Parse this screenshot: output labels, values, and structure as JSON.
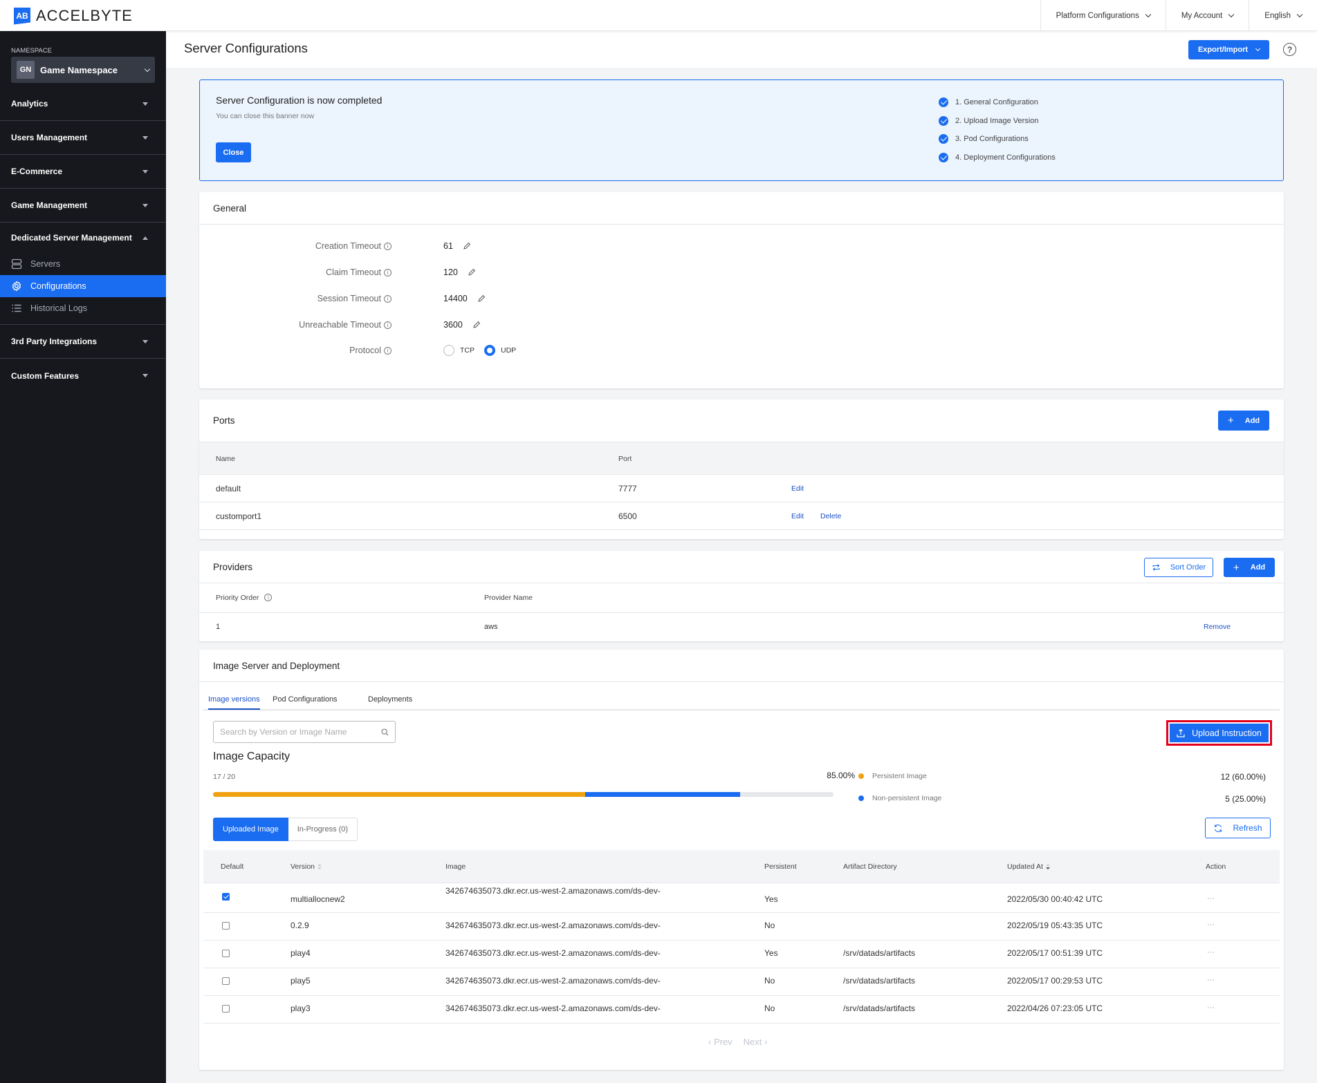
{
  "topbar": {
    "brand": "ACCELBYTE",
    "logo_mark": "AB",
    "nav": [
      {
        "label": "Platform Configurations"
      },
      {
        "label": "My Account"
      },
      {
        "label": "English"
      }
    ]
  },
  "sidebar": {
    "namespace_label": "NAMESPACE",
    "namespace_initials": "GN",
    "namespace_name": "Game Namespace",
    "groups": [
      {
        "label": "Analytics",
        "expanded": false
      },
      {
        "label": "Users Management",
        "expanded": false
      },
      {
        "label": "E-Commerce",
        "expanded": false
      },
      {
        "label": "Game Management",
        "expanded": false
      },
      {
        "label": "Dedicated Server Management",
        "expanded": true
      },
      {
        "label": "3rd Party Integrations",
        "expanded": false
      },
      {
        "label": "Custom Features",
        "expanded": false
      }
    ],
    "dsm_items": [
      {
        "label": "Servers",
        "icon": "server-icon",
        "active": false
      },
      {
        "label": "Configurations",
        "icon": "gear-icon",
        "active": true
      },
      {
        "label": "Historical Logs",
        "icon": "list-icon",
        "active": false
      }
    ]
  },
  "page": {
    "title": "Server Configurations",
    "export_label": "Export/Import",
    "help_icon": "?"
  },
  "banner": {
    "title": "Server Configuration is now completed",
    "subtitle": "You can close this banner now",
    "close_label": "Close",
    "steps": [
      {
        "label": "1. General Configuration",
        "done": true
      },
      {
        "label": "2. Upload Image Version",
        "done": true
      },
      {
        "label": "3. Pod Configurations",
        "done": true
      },
      {
        "label": "4. Deployment Configurations",
        "done": true
      }
    ]
  },
  "general": {
    "title": "General",
    "fields": [
      {
        "label": "Creation Timeout",
        "value": "61"
      },
      {
        "label": "Claim Timeout",
        "value": "120"
      },
      {
        "label": "Session Timeout",
        "value": "14400"
      },
      {
        "label": "Unreachable Timeout",
        "value": "3600"
      }
    ],
    "protocol_label": "Protocol",
    "protocol_options": [
      "TCP",
      "UDP"
    ],
    "protocol_selected": "UDP"
  },
  "ports": {
    "title": "Ports",
    "add_label": "Add",
    "columns": [
      "Name",
      "Port"
    ],
    "rows": [
      {
        "name": "default",
        "port": "7777",
        "actions": [
          "Edit"
        ]
      },
      {
        "name": "customport1",
        "port": "6500",
        "actions": [
          "Edit",
          "Delete"
        ]
      }
    ]
  },
  "providers": {
    "title": "Providers",
    "sort_label": "Sort Order",
    "add_label": "Add",
    "columns": [
      "Priority Order",
      "Provider Name"
    ],
    "rows": [
      {
        "priority": "1",
        "name": "aws",
        "action": "Remove"
      }
    ]
  },
  "images": {
    "title": "Image Server and Deployment",
    "tabs": [
      {
        "label": "Image versions",
        "active": true
      },
      {
        "label": "Pod Configurations",
        "active": false
      },
      {
        "label": "Deployments",
        "active": false
      }
    ],
    "search_placeholder": "Search by Version or Image Name",
    "search_value": "",
    "upload_label": "Upload Instruction",
    "capacity": {
      "title": "Image Capacity",
      "count": "17 / 20",
      "used": 17,
      "total": 20,
      "percent_label": "85.00%",
      "persistent_fraction": 0.6,
      "nonpersistent_fraction": 0.25,
      "legend": [
        {
          "label": "Persistent Image",
          "value": "12 (60.00%)",
          "color": "#f0a10f"
        },
        {
          "label": "Non-persistent Image",
          "value": "5 (25.00%)",
          "color": "#1a6cf0"
        }
      ]
    },
    "segments": [
      {
        "label": "Uploaded Image",
        "active": true
      },
      {
        "label": "In-Progress (0)",
        "active": false
      }
    ],
    "refresh_label": "Refresh",
    "columns": [
      "Default",
      "Version",
      "Image",
      "Persistent",
      "Artifact Directory",
      "Updated At",
      "Action"
    ],
    "rows": [
      {
        "default": true,
        "version": "multiallocnew2",
        "image": "342674635073.dkr.ecr.us-west-2.amazonaws.com/ds-dev-",
        "persistent": "Yes",
        "artifact": "",
        "updated": "2022/05/30 00:40:42 UTC",
        "action": "···"
      },
      {
        "default": false,
        "version": "0.2.9",
        "image": "342674635073.dkr.ecr.us-west-2.amazonaws.com/ds-dev-",
        "persistent": "No",
        "artifact": "",
        "updated": "2022/05/19 05:43:35 UTC",
        "action": "···"
      },
      {
        "default": false,
        "version": "play4",
        "image": "342674635073.dkr.ecr.us-west-2.amazonaws.com/ds-dev-",
        "persistent": "Yes",
        "artifact": "/srv/datads/artifacts",
        "updated": "2022/05/17 00:51:39 UTC",
        "action": "···"
      },
      {
        "default": false,
        "version": "play5",
        "image": "342674635073.dkr.ecr.us-west-2.amazonaws.com/ds-dev-",
        "persistent": "No",
        "artifact": "/srv/datads/artifacts",
        "updated": "2022/05/17 00:29:53 UTC",
        "action": "···"
      },
      {
        "default": false,
        "version": "play3",
        "image": "342674635073.dkr.ecr.us-west-2.amazonaws.com/ds-dev-",
        "persistent": "No",
        "artifact": "/srv/datads/artifacts",
        "updated": "2022/04/26 07:23:05 UTC",
        "action": "···"
      }
    ],
    "pager": {
      "prev": "‹ Prev",
      "next": "Next ›"
    }
  },
  "colors": {
    "accent": "#1a6cf0",
    "sidebar_bg": "#16181d",
    "persistent": "#f0a10f",
    "highlight_border": "#e3001b"
  }
}
